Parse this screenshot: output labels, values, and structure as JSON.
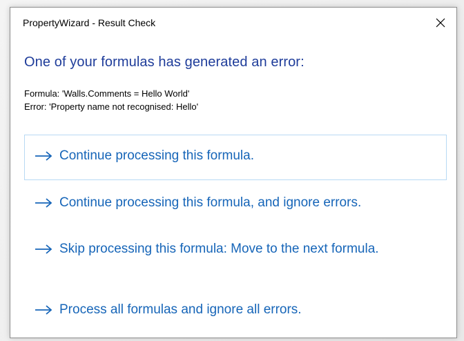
{
  "window": {
    "title": "PropertyWizard - Result Check"
  },
  "main_instruction": "One of your formulas has generated an error:",
  "details": {
    "formula": "Formula: 'Walls.Comments = Hello World'",
    "error": "Error: 'Property name not recognised: Hello'"
  },
  "command_links": [
    {
      "label": "Continue processing this formula.",
      "focused": true
    },
    {
      "label": "Continue processing this formula, and ignore errors.",
      "focused": false
    },
    {
      "label": "Skip processing this formula: Move to the next formula.",
      "focused": false
    },
    {
      "label": "Process all formulas and ignore all errors.",
      "focused": false
    }
  ],
  "icons": {
    "close": "close-icon",
    "command_arrow": "arrow-right-icon"
  },
  "colors": {
    "instruction": "#1e3c9a",
    "command_link": "#1665b8",
    "focus_border": "#b7d9f4"
  }
}
